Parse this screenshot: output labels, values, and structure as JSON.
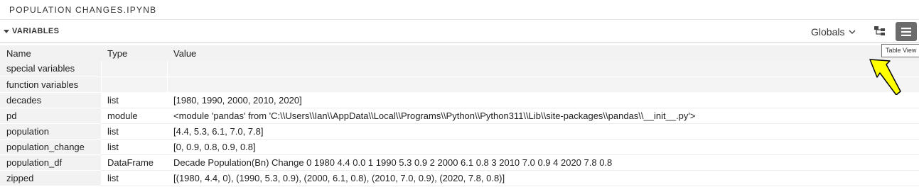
{
  "title": "POPULATION CHANGES.IPYNB",
  "section": {
    "title": "VARIABLES",
    "scope": "Globals",
    "tooltip": "Table View"
  },
  "table": {
    "headers": {
      "name": "Name",
      "type": "Type",
      "value": "Value"
    },
    "groups": [
      {
        "name": "special variables"
      },
      {
        "name": "function variables"
      }
    ],
    "rows": [
      {
        "name": "decades",
        "type": "list",
        "value": "[1980, 1990, 2000, 2010, 2020]"
      },
      {
        "name": "pd",
        "type": "module",
        "value": "<module 'pandas' from 'C:\\\\Users\\\\Ian\\\\AppData\\\\Local\\\\Programs\\\\Python\\\\Python311\\\\Lib\\\\site-packages\\\\pandas\\\\__init__.py'>"
      },
      {
        "name": "population",
        "type": "list",
        "value": "[4.4, 5.3, 6.1, 7.0, 7.8]"
      },
      {
        "name": "population_change",
        "type": "list",
        "value": "[0, 0.9, 0.8, 0.9, 0.8]"
      },
      {
        "name": "population_df",
        "type": "DataFrame",
        "value": "   Decade  Population(Bn)  Change 0    1980            4.4     0.0 1    1990            5.3     0.9 2    2000            6.1     0.8 3    2010            7.0     0.9 4    2020            7.8     0.8"
      },
      {
        "name": "zipped",
        "type": "list",
        "value": "[(1980, 4.4, 0), (1990, 5.3, 0.9), (2000, 6.1, 0.8), (2010, 7.0, 0.9), (2020, 7.8, 0.8)]"
      }
    ]
  },
  "icons": {
    "collapse": "chevron-down-icon",
    "scope_dropdown": "chevron-down-icon",
    "tree_view": "tree-view-icon",
    "table_view": "table-view-icon",
    "cursor_arrow": "arrow-pointer-icon"
  },
  "colors": {
    "table_view_button": "#6b6b6b",
    "arrow_fill": "#ffff00"
  }
}
